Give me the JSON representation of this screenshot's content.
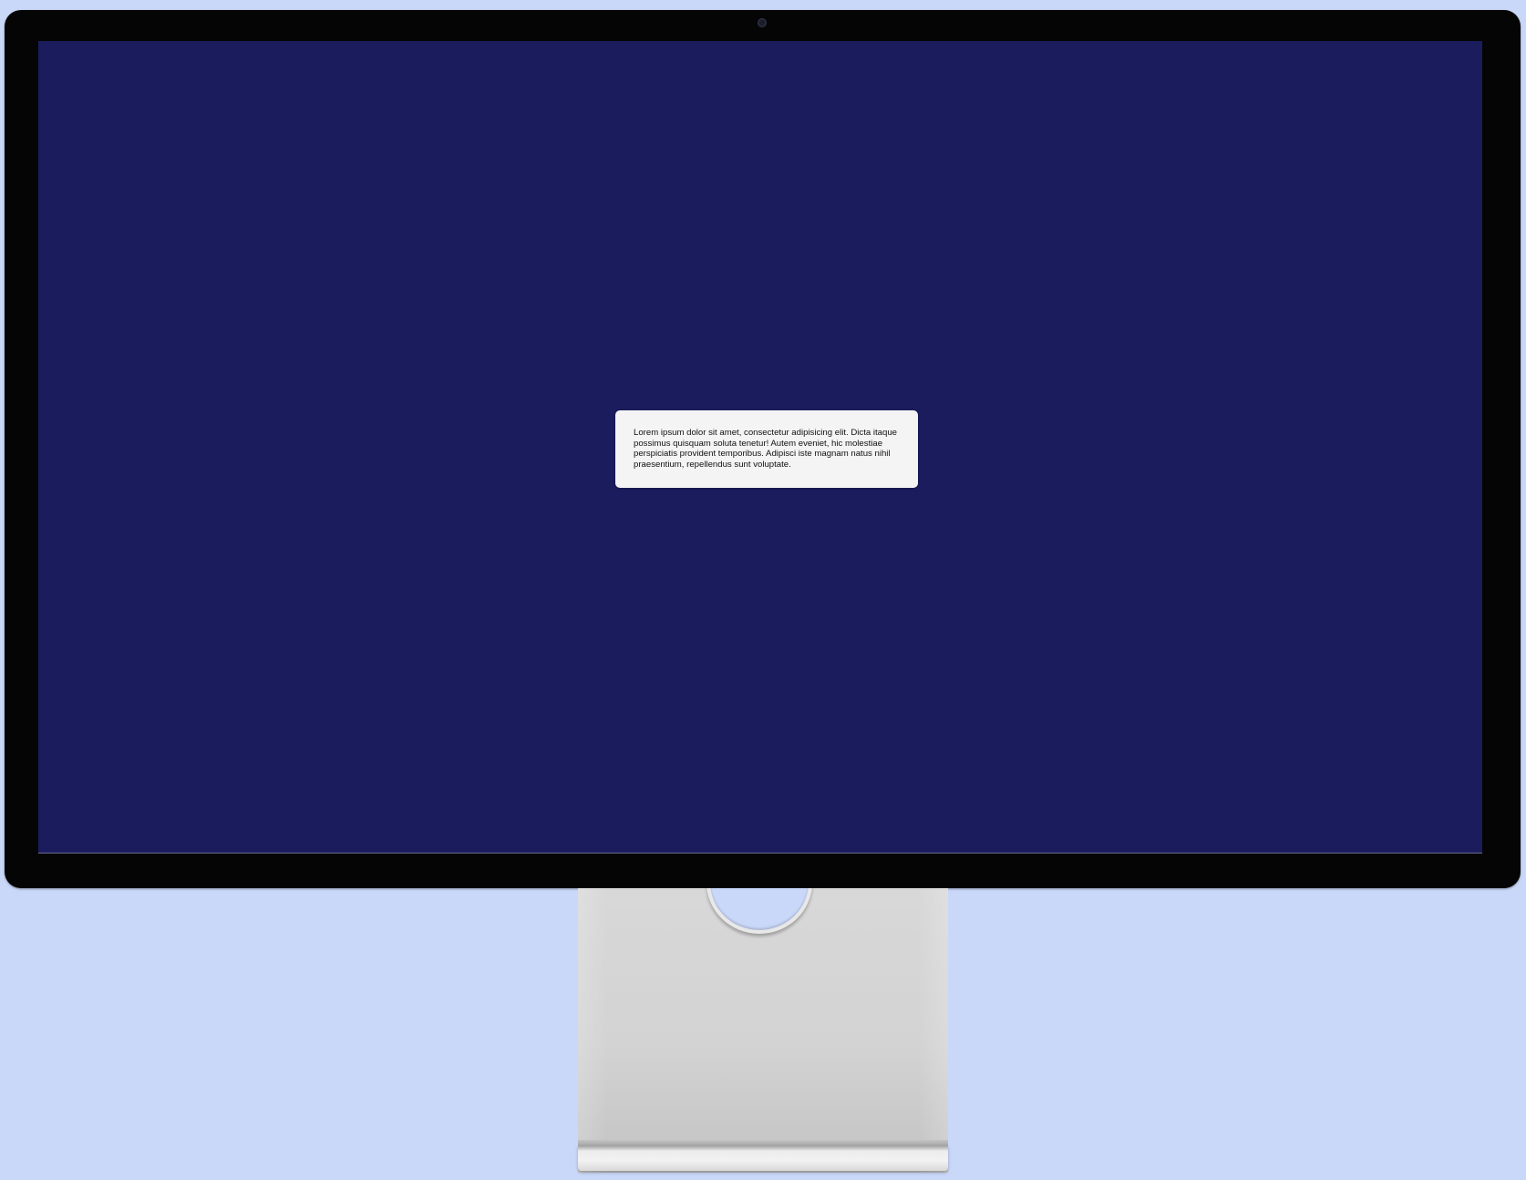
{
  "monitor": {
    "screen": {
      "dialog": {
        "text": "Lorem ipsum dolor sit amet, consectetur adipisicing elit. Dicta itaque possimus quisquam soluta tenetur! Autem eveniet, hic molestiae perspiciatis provident temporibus. Adipisci iste magnam natus nihil praesentium, repellendus sunt voluptate."
      }
    }
  },
  "colors": {
    "background": "#c9d7f8",
    "bezel": "#050505",
    "screen": "#1b1c5e",
    "dialog": "#f4f4f4",
    "stand": "#d6d6d6"
  }
}
